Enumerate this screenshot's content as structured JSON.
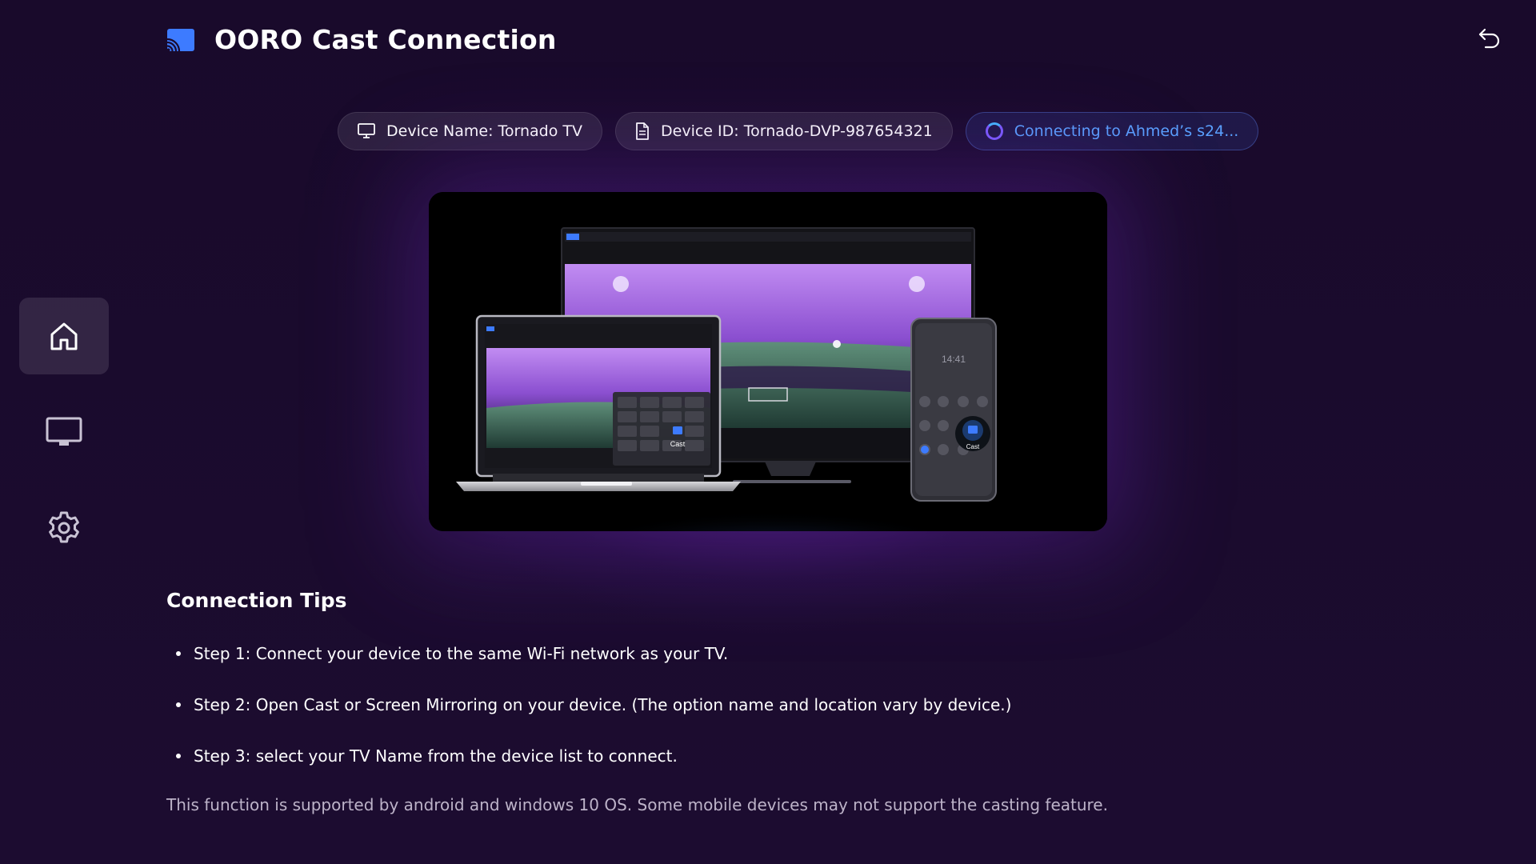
{
  "header": {
    "title": "OORO Cast Connection",
    "logo_icon": "cast-logo-icon",
    "back_icon": "back-arrow-icon"
  },
  "sidebar": {
    "items": [
      {
        "icon": "home-icon",
        "active": true
      },
      {
        "icon": "tv-icon",
        "active": false
      },
      {
        "icon": "gear-icon",
        "active": false
      }
    ]
  },
  "chips": {
    "device_name": "Device Name: Tornado TV",
    "device_id": "Device ID: Tornado-DVP-987654321",
    "status": "Connecting to Ahmed’s s24..."
  },
  "hero": {
    "laptop_cast_label": "Cast",
    "phone_cast_label": "Cast",
    "phone_time": "14:41"
  },
  "tips": {
    "title": "Connection Tips",
    "items": [
      "Step 1: Connect your device to the same Wi-Fi network as your TV.",
      "Step 2: Open Cast or Screen Mirroring on your device. (The option name and location vary by device.)",
      "Step 3: select your TV Name from the device list to connect."
    ],
    "footnote": "This function is supported by android and windows 10 OS. Some mobile devices may not support the casting feature."
  },
  "colors": {
    "background": "#1a0a2c",
    "accent_blue": "#3d7bff",
    "status_text": "#5aa0ff",
    "muted_text": "#bdb3c9"
  }
}
